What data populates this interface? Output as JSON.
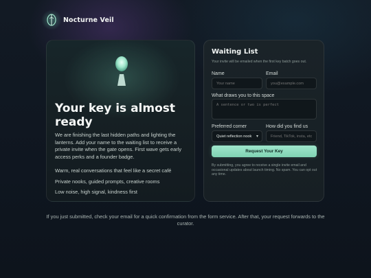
{
  "brand": {
    "name": "Nocturne Veil",
    "logo_icon": "lantern-icon"
  },
  "hero": {
    "art_icon": "keyhole-lantern-icon",
    "title": "Your key is almost ready",
    "description": "We are finishing the last hidden paths and lighting the lanterns. Add your name to the waiting list to receive a private invite when the gate opens. First wave gets early access perks and a founder badge.",
    "features": [
      "Warm, real conversations that feel like a secret café",
      "Private nooks, guided prompts, creative rooms",
      "Low noise, high signal, kindness first"
    ]
  },
  "form": {
    "title": "Waiting List",
    "subtitle": "Your invite will be emailed when the first key batch goes out.",
    "name_label": "Name",
    "name_placeholder": "Your name",
    "email_label": "Email",
    "email_placeholder": "you@example.com",
    "draw_label": "What draws you to this space",
    "draw_placeholder": "A sentence or two is perfect",
    "corner_label": "Preferred corner",
    "corner_value": "Quiet reflection nook",
    "found_label": "How did you find us",
    "found_placeholder": "Friend, TikTok, insta, etc",
    "submit_label": "Request Your Key",
    "disclaimer": "By submitting, you agree to receive a single invite email and occasional updates about launch timing. No spam. You can opt out any time."
  },
  "footer": {
    "note": "If you just submitted, check your email for a quick confirmation from the form service. After that, your request forwards to the curator."
  },
  "colors": {
    "accent": "#8fdcbf",
    "background": "#10171f",
    "card": "#171f24"
  }
}
